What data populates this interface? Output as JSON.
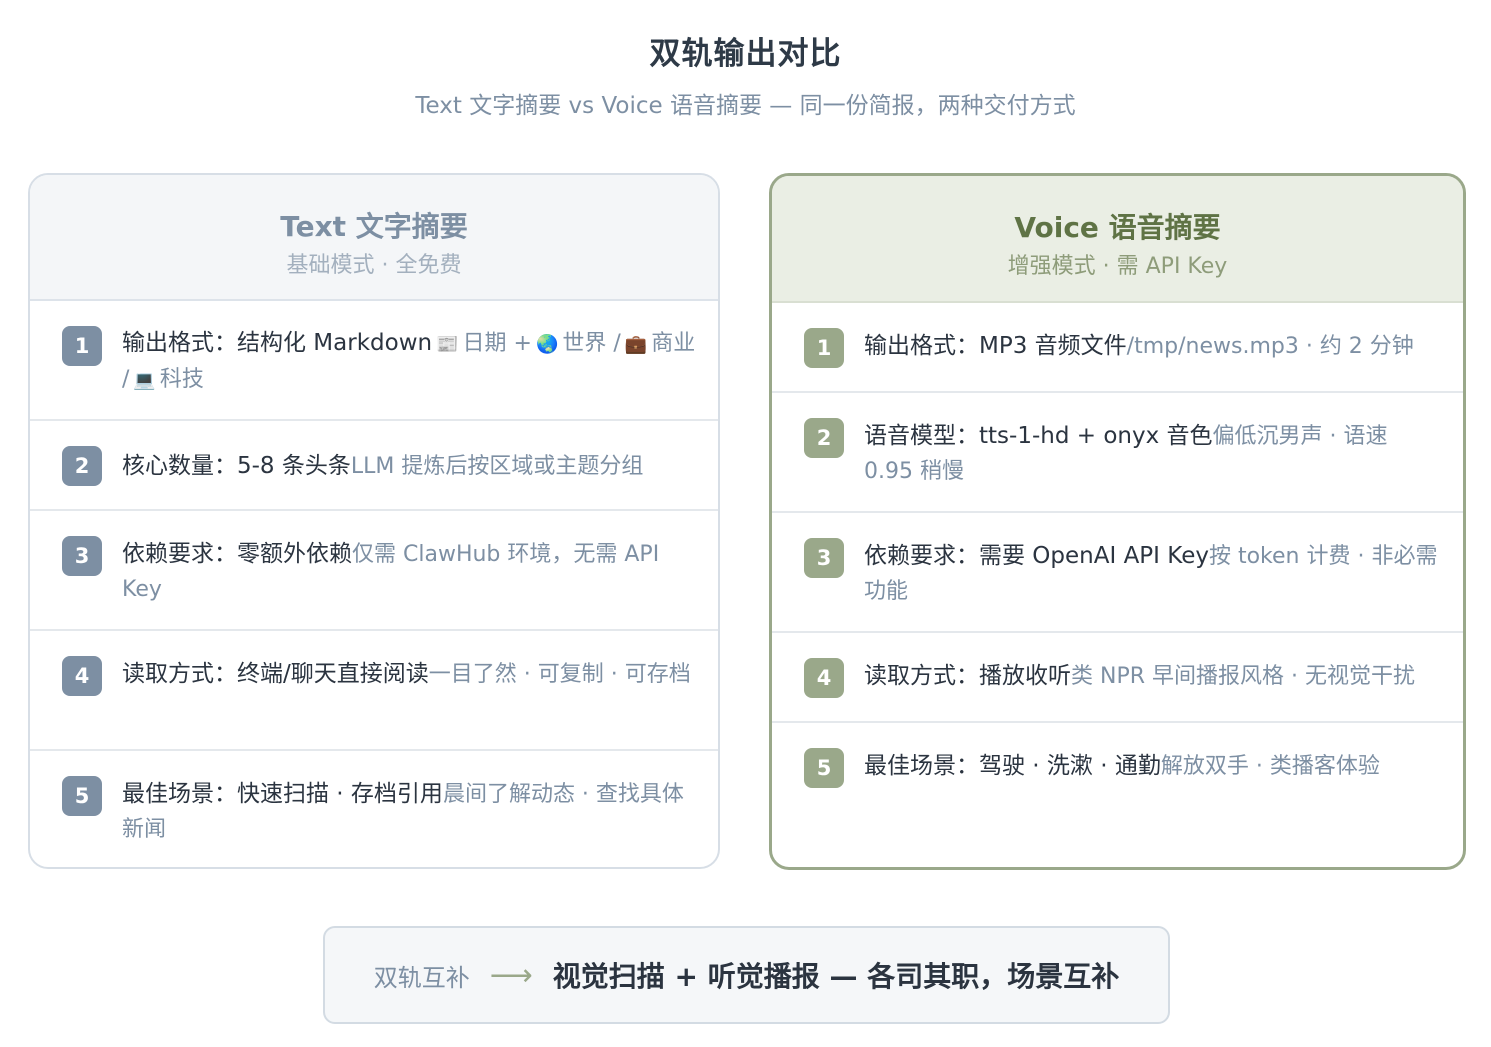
{
  "title": "双轨输出对比",
  "subtitle": "Text 文字摘要 vs Voice 语音摘要 — 同一份简报，两种交付方式",
  "text_card": {
    "title": "Text 文字摘要",
    "subtitle": "基础模式 · 全免费",
    "items": [
      {
        "num": "1",
        "label": "输出格式：",
        "value": "结构化 Markdown",
        "note_parts": [
          "📰",
          "日期 +",
          "🌏",
          "世界 /",
          "💼",
          "商业 /",
          "💻",
          "科技"
        ]
      },
      {
        "num": "2",
        "label": "核心数量：",
        "value": "5-8 条头条",
        "note": "LLM 提炼后按区域或主题分组"
      },
      {
        "num": "3",
        "label": "依赖要求：",
        "value": "零额外依赖",
        "note": "仅需 ClawHub 环境，无需 API Key"
      },
      {
        "num": "4",
        "label": "读取方式：",
        "value": "终端/聊天直接阅读",
        "note": "一目了然 · 可复制 · 可存档"
      },
      {
        "num": "5",
        "label": "最佳场景：",
        "value": "快速扫描 · 存档引用",
        "note": "晨间了解动态 · 查找具体新闻"
      }
    ]
  },
  "voice_card": {
    "title": "Voice 语音摘要",
    "subtitle": "增强模式 · 需 API Key",
    "items": [
      {
        "num": "1",
        "label": "输出格式：",
        "value": "MP3 音频文件",
        "note": "/tmp/news.mp3 · 约 2 分钟"
      },
      {
        "num": "2",
        "label": "语音模型：",
        "value": "tts-1-hd + onyx 音色",
        "note": "偏低沉男声 · 语速 0.95 稍慢"
      },
      {
        "num": "3",
        "label": "依赖要求：",
        "value": "需要 OpenAI API Key",
        "note": "按 token 计费 · 非必需功能"
      },
      {
        "num": "4",
        "label": "读取方式：",
        "value": "播放收听",
        "note": "类 NPR 早间播报风格 · 无视觉干扰"
      },
      {
        "num": "5",
        "label": "最佳场景：",
        "value": "驾驶 · 洗漱 · 通勤",
        "note": "解放双手 · 类播客体验"
      }
    ]
  },
  "bottom": {
    "label": "双轨互补",
    "arrow": "⟶",
    "text": "视觉扫描 + 听觉播报 — 各司其职，场景互补"
  },
  "colors": {
    "text_accent": "#7d8fa3",
    "voice_accent": "#9aa88a",
    "voice_title": "#5f7345"
  }
}
